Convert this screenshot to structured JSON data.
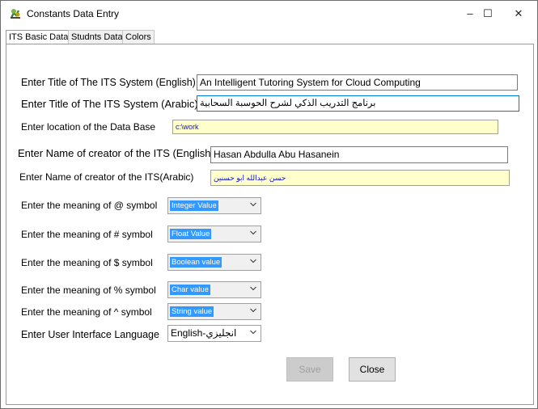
{
  "window": {
    "title": "Constants Data Entry",
    "minimize_glyph": "–",
    "maximize_glyph": "☐",
    "close_glyph": "✕"
  },
  "tabs": [
    {
      "label": "ITS Basic Data",
      "active": true
    },
    {
      "label": "Studnts Data",
      "active": false
    },
    {
      "label": "Colors",
      "active": false
    }
  ],
  "form": {
    "title_en_label": "Enter Title of The ITS System (English)",
    "title_en_value": "An Intelligent Tutoring System for Cloud Computing",
    "title_ar_label": "Enter Title of The ITS System (Arabic)",
    "title_ar_value": "برنامج التدريب الذكي لشرح الحوسبة السحابية",
    "db_label": "Enter location of the Data Base",
    "db_value": "c:\\work",
    "creator_en_label": "Enter Name of creator of the ITS (English)",
    "creator_en_value": "Hasan Abdulla Abu Hasanein",
    "creator_ar_label": "Enter Name of creator of the ITS(Arabic)",
    "creator_ar_value": "حسن عبدالله ابو حسنين",
    "at_label": "Enter the meaning of @ symbol",
    "at_value": "Integer Value",
    "hash_label": "Enter the meaning of # symbol",
    "hash_value": "Float Value",
    "dollar_label": "Enter the meaning of $ symbol",
    "dollar_value": "Boolean value",
    "percent_label": "Enter the meaning of % symbol",
    "percent_value": "Char value",
    "caret_label": "Enter the meaning of ^ symbol",
    "caret_value": "String value",
    "lang_label": "Enter User Interface Language",
    "lang_value": "English-انجليزي"
  },
  "buttons": {
    "save_label": "Save",
    "close_label": "Close"
  },
  "colors": {
    "highlight": "#3399ff",
    "readonly_bg": "#ffffcc",
    "focus_border": "#0078d7"
  }
}
